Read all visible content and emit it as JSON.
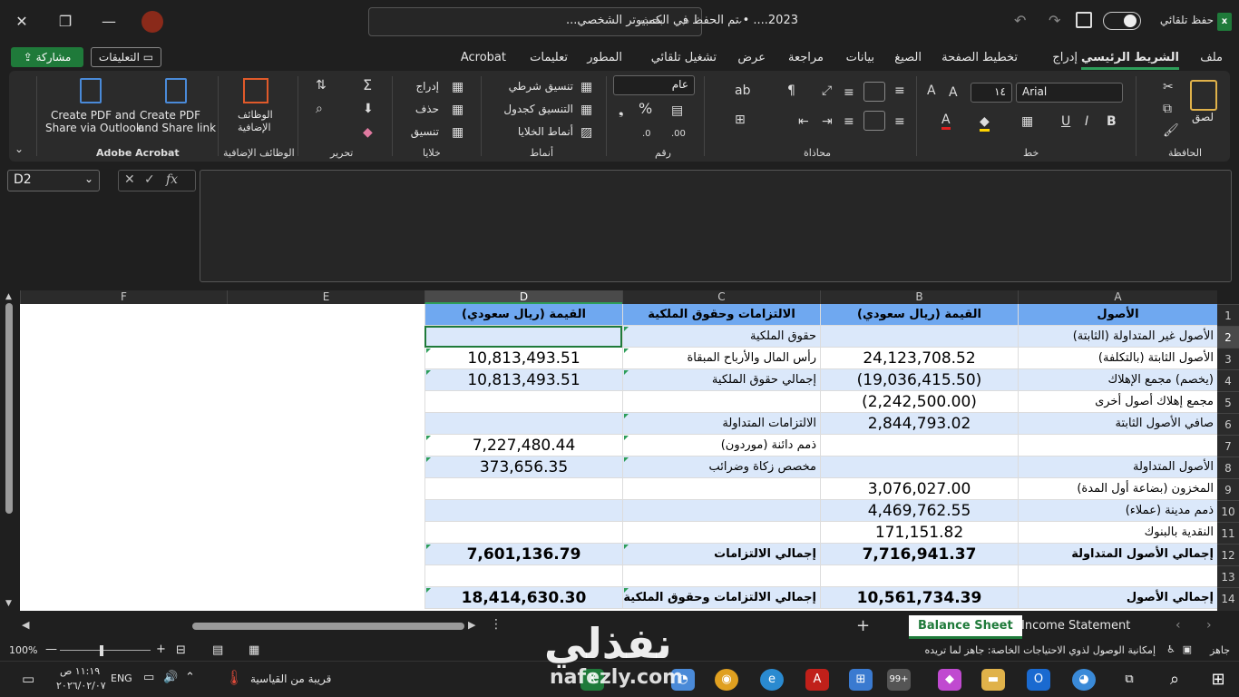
{
  "window": {
    "doc_title": "2023.... • تم الحفظ في الكمبيوتر الشخصي...",
    "autosave_label": "حفظ تلقائي",
    "search_placeholder": "بحث",
    "close": "✕",
    "restore": "❐",
    "minimize": "—"
  },
  "tabs": [
    {
      "label": "ملف"
    },
    {
      "label": "الشريط الرئيسي"
    },
    {
      "label": "إدراج"
    },
    {
      "label": "تخطيط الصفحة"
    },
    {
      "label": "الصيغ"
    },
    {
      "label": "بيانات"
    },
    {
      "label": "مراجعة"
    },
    {
      "label": "عرض"
    },
    {
      "label": "تشغيل تلقائي"
    },
    {
      "label": "المطور"
    },
    {
      "label": "تعليمات"
    },
    {
      "label": "Acrobat"
    }
  ],
  "share_label": "مشاركة",
  "comments_label": "التعليقات",
  "ribbon": {
    "groups": [
      "الحافظة",
      "خط",
      "محاذاة",
      "رقم",
      "أنماط",
      "خلايا",
      "تحرير",
      "الوظائف الإضافية",
      "Adobe Acrobat"
    ],
    "paste": "لصق",
    "font_name": "Arial",
    "font_size": "١٤",
    "number_format": "عام",
    "cond_format": "تنسيق شرطي",
    "table_format": "التنسيق كجدول",
    "cell_styles": "أنماط الخلايا",
    "insert": "إدراج",
    "delete": "حذف",
    "format": "تنسيق",
    "addins_line1": "الوظائف",
    "addins_line2": "الإضافية",
    "pdf1_line1": "Create PDF and",
    "pdf1_line2": "Share via Outlook",
    "pdf2_line1": "Create PDF",
    "pdf2_line2": "and Share link"
  },
  "namebox": "D2",
  "columns": [
    "A",
    "B",
    "C",
    "D",
    "E",
    "F"
  ],
  "rows": [
    {
      "n": "1",
      "a": "الأصول",
      "b": "القيمة (ريال سعودي)",
      "c": "الالتزامات وحقوق الملكية",
      "d": "القيمة (ريال سعودي)"
    },
    {
      "n": "2",
      "a": "الأصول غير المتداولة (الثابتة)",
      "b": "",
      "c": "حقوق الملكية",
      "d": ""
    },
    {
      "n": "3",
      "a": "الأصول الثابتة (بالتكلفة)",
      "b": "24,123,708.52",
      "c": "رأس المال والأرباح المبقاة",
      "d": "10,813,493.51"
    },
    {
      "n": "4",
      "a": "(يخصم) مجمع الإهلاك",
      "b": "(19,036,415.50)",
      "c": "إجمالي حقوق الملكية",
      "d": "10,813,493.51"
    },
    {
      "n": "5",
      "a": "مجمع إهلاك أصول أخرى",
      "b": "(2,242,500.00)",
      "c": "",
      "d": ""
    },
    {
      "n": "6",
      "a": "صافي الأصول الثابتة",
      "b": "2,844,793.02",
      "c": "الالتزامات المتداولة",
      "d": ""
    },
    {
      "n": "7",
      "a": "",
      "b": "",
      "c": "ذمم دائنة (موردون)",
      "d": "7,227,480.44"
    },
    {
      "n": "8",
      "a": "الأصول المتداولة",
      "b": "",
      "c": "مخصص زكاة وضرائب",
      "d": "373,656.35"
    },
    {
      "n": "9",
      "a": "المخزون (بضاعة أول المدة)",
      "b": "3,076,027.00",
      "c": "",
      "d": ""
    },
    {
      "n": "10",
      "a": "ذمم مدينة (عملاء)",
      "b": "4,469,762.55",
      "c": "",
      "d": ""
    },
    {
      "n": "11",
      "a": "النقدية بالبنوك",
      "b": "171,151.82",
      "c": "",
      "d": ""
    },
    {
      "n": "12",
      "a": "إجمالي الأصول المتداولة",
      "b": "7,716,941.37",
      "c": "إجمالي الالتزامات",
      "d": "7,601,136.79"
    },
    {
      "n": "13",
      "a": "",
      "b": "",
      "c": "",
      "d": ""
    },
    {
      "n": "14",
      "a": "إجمالي الأصول",
      "b": "10,561,734.39",
      "c": "إجمالي الالتزامات وحقوق الملكية",
      "d": "18,414,630.30"
    }
  ],
  "sheets": {
    "active": "Balance Sheet",
    "other": "Income Statement"
  },
  "status": {
    "ready": "جاهز",
    "accessibility": "إمكانية الوصول لذوي الاحتياجات الخاصة: جاهز لما تريده",
    "zoom": "100%"
  },
  "taskbar": {
    "time": "١١:١٩ ص",
    "date": "٢٠٢٦/٠٢/٠٧",
    "lang": "ENG",
    "weather": "قريبة من القياسية",
    "badge": "99+"
  },
  "watermark": {
    "arabic": "نفذلي",
    "latin": "nafezly.com"
  },
  "colors": {
    "accent": "#1f7a3a",
    "header_fill": "#6fa8f0",
    "band_fill": "#dbe8fa"
  }
}
